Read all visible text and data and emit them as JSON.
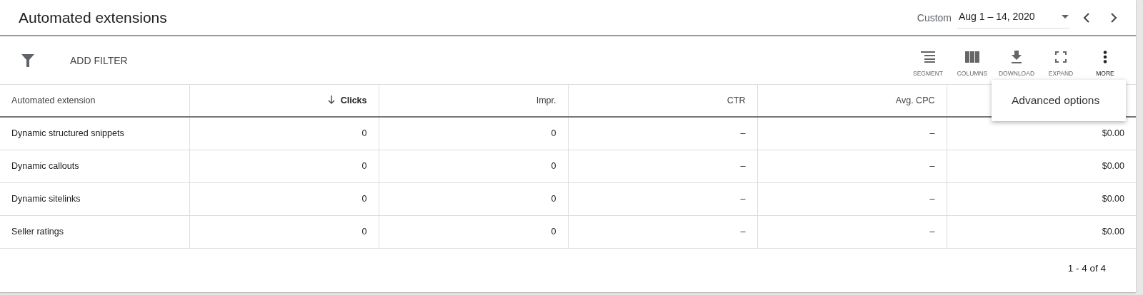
{
  "page_title": "Automated extensions",
  "date_range": {
    "label": "Custom",
    "value": "Aug 1 – 14, 2020"
  },
  "toolbar": {
    "filter_label": "ADD FILTER",
    "actions": [
      {
        "kind": "segment",
        "label": "SEGMENT"
      },
      {
        "kind": "columns",
        "label": "COLUMNS"
      },
      {
        "kind": "download",
        "label": "DOWNLOAD"
      },
      {
        "kind": "expand",
        "label": "EXPAND"
      },
      {
        "kind": "more",
        "label": "MORE",
        "selected": true
      }
    ]
  },
  "menu": {
    "items": [
      "Advanced options"
    ]
  },
  "table": {
    "columns": [
      {
        "label": "Automated extension",
        "sorted": false
      },
      {
        "label": "Clicks",
        "sorted": true
      },
      {
        "label": "Impr.",
        "sorted": false
      },
      {
        "label": "CTR",
        "sorted": false
      },
      {
        "label": "Avg. CPC",
        "sorted": false
      },
      {}
    ],
    "rows": [
      [
        "Dynamic structured snippets",
        "0",
        "0",
        "–",
        "–",
        "$0.00"
      ],
      [
        "Dynamic callouts",
        "0",
        "0",
        "–",
        "–",
        "$0.00"
      ],
      [
        "Dynamic sitelinks",
        "0",
        "0",
        "–",
        "–",
        "$0.00"
      ],
      [
        "Seller ratings",
        "0",
        "0",
        "–",
        "–",
        "$0.00"
      ]
    ]
  },
  "pagination": "1 - 4 of 4"
}
